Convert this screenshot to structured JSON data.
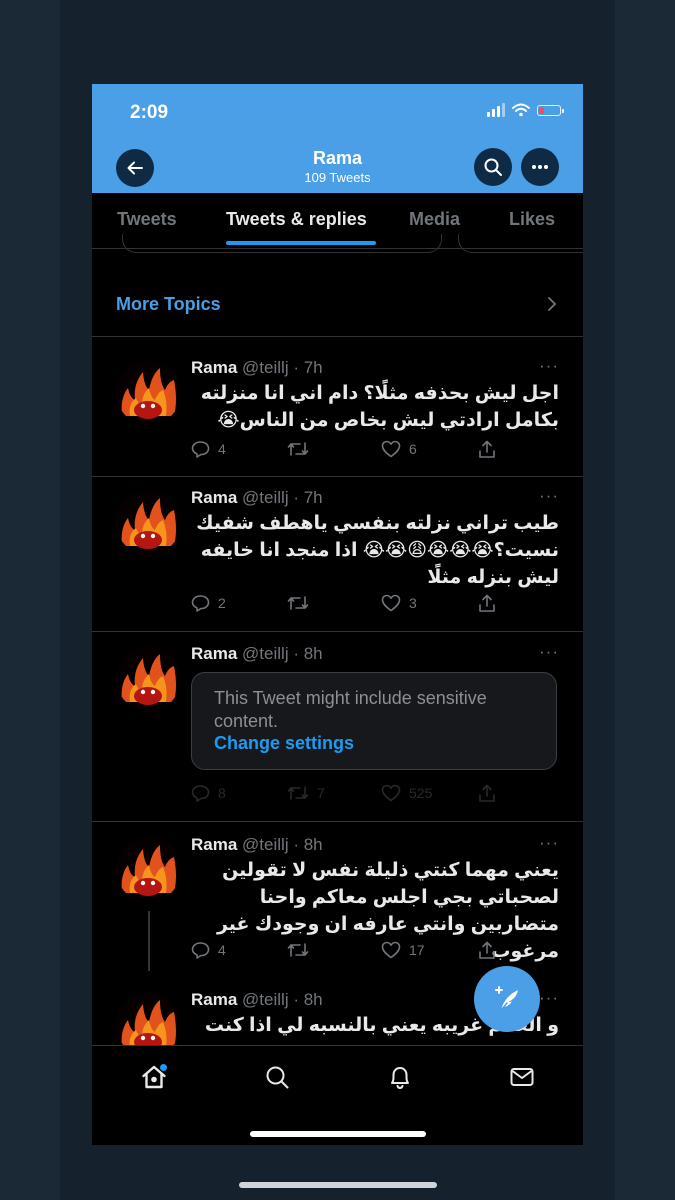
{
  "status_bar": {
    "time": "2:09"
  },
  "header": {
    "title": "Rama",
    "subtitle": "109 Tweets",
    "back_icon": "arrow-left-icon",
    "search_icon": "search-icon",
    "more_icon": "more-horizontal-icon",
    "background_color": "#4b9fe6"
  },
  "tabs": [
    {
      "label": "Tweets",
      "active": false
    },
    {
      "label": "Tweets & replies",
      "active": true
    },
    {
      "label": "Media",
      "active": false
    },
    {
      "label": "Likes",
      "active": false
    }
  ],
  "more_topics": {
    "label": "More Topics",
    "icon": "chevron-right-icon"
  },
  "tweets": [
    {
      "name": "Rama",
      "handle": "@teillj",
      "time": "· 7h",
      "more": "···",
      "text": "اجل ليش بحذفه مثلًا؟ دام اني انا منزلته بكامل ارادتي ليش بخاص من الناس😭",
      "replies": "4",
      "retweets": "",
      "likes": "6"
    },
    {
      "name": "Rama",
      "handle": "@teillj",
      "time": "· 7h",
      "more": "···",
      "text": "طيب تراني نزلته بنفسي ياهطف شفيك نسيت؟😭😭😭😩😭😭 اذا منجد انا خايفه ليش بنزله مثلًا",
      "replies": "2",
      "retweets": "",
      "likes": "3"
    },
    {
      "name": "Rama",
      "handle": "@teillj",
      "time": "· 8h",
      "more": "···",
      "sensitive_text": "This Tweet might include sensitive content.",
      "sensitive_link": "Change settings",
      "replies": "8",
      "retweets": "7",
      "likes": "525"
    },
    {
      "name": "Rama",
      "handle": "@teillj",
      "time": "· 8h",
      "more": "···",
      "text": "يعني مهما كنتي ذليلة نفس لا تقولين لصحباتي بجي اجلس معاكم واحنا متضاربين وانتي عارفه ان وجودك غير مرغوب",
      "replies": "4",
      "retweets": "",
      "likes": "17"
    },
    {
      "name": "Rama",
      "handle": "@teillj",
      "time": "· 8h",
      "more": "···",
      "text": "و العالم غريبه يعني بالنسبه لي اذا كنت"
    }
  ],
  "compose_button": {
    "icon": "compose-feather-icon"
  },
  "bottom_nav": [
    {
      "icon": "home-icon",
      "active": true
    },
    {
      "icon": "search-icon"
    },
    {
      "icon": "bell-icon"
    },
    {
      "icon": "mail-icon"
    }
  ],
  "colors": {
    "accent": "#1d9bf0",
    "background": "#000000",
    "muted": "#71767b"
  }
}
